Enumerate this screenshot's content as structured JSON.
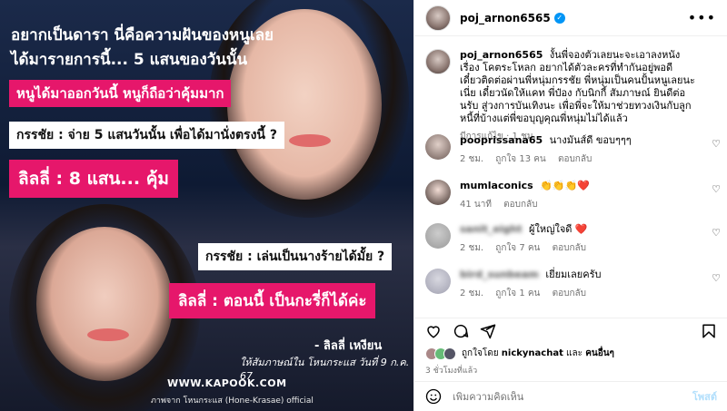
{
  "image": {
    "headline_line1": "อยากเป็นดารา นี่คือความฝันของหนูเลย",
    "headline_line2": "ได้มารายการนี้... 5 แสนของวันนั้น",
    "pink1": "หนูได้มาออกวันนี้ หนูก็ถือว่าคุ้มมาก",
    "white1": "กรรชัย : จ่าย 5 แสนวันนั้น เพื่อได้มานั่งตรงนี้ ?",
    "pink2": "ลิลลี่ : 8 แสน... คุ้ม",
    "white2": "กรรชัย : เล่นเป็นนางร้ายได้มั้ย ?",
    "pink3": "ลิลลี่ : ตอนนี้ เป็นกะรี่ก็ได้ค่ะ",
    "signer": "- ลิลลี่ เหงียน",
    "interview": "ให้สัมภาษณ์ใน โหนกระแส วันที่ 9 ก.ค. 67",
    "site": "WWW.KAPOOK.COM",
    "credit": "ภาพจาก โหนกระแส (Hone-Krasae) official",
    "colors": {
      "pink": "#e6176b",
      "bg": "#1b2a4a"
    }
  },
  "header": {
    "username": "poj_arnon6565",
    "verified_icon": "verified-badge-icon",
    "more_icon": "more-options-icon"
  },
  "caption": {
    "username": "poj_arnon6565",
    "text": "งั้นพี่จองตัวเลยนะจะเอาลงหนังเรื่อง โคตระโหลก อยากได้ตัวละครที่ทำกันอยู่พอดี เดี๋ยวติดต่อผ่านพี่หนุ่มกรรชัย พี่หนุ่มเป็นคนปั้นหนูเลยนะเนี่ย เดี๋ยวนัดให้แคท พี่ป๋อง กับนิกกี้ สัมภาษณ์ ยินดีต่อนรับ สู่วงการบันเทิงนะ เพื่อพี่จะให้มาช่วยทวงเงินกับลูกหนี้ที่บ้างแต่พี่ขอบุญคุณพี่หนุ่มไม่ได้แล้ว",
    "meta": "มีการแก้ไข · 1 ชม."
  },
  "comments": [
    {
      "user": "pooprissana65",
      "text": "นางมันส์ดี ขอบๆๆๆ",
      "time": "2 ชม.",
      "likes": "ถูกใจ 13 คน",
      "reply": "ตอบกลับ"
    },
    {
      "user": "mumlaconics",
      "text": "👏👏👏❤️",
      "time": "41 นาที",
      "likes": "",
      "reply": "ตอบกลับ"
    },
    {
      "user": "sanit_eight",
      "text": "ผู้ใหญ่ใจดี ❤️",
      "time": "2 ชม.",
      "likes": "ถูกใจ 7 คน",
      "reply": "ตอบกลับ"
    },
    {
      "user": "bird_sunbeam",
      "text": "เยี่ยมเลยครับ",
      "time": "2 ชม.",
      "likes": "ถูกใจ 1 คน",
      "reply": "ตอบกลับ"
    }
  ],
  "actions": {
    "like_icon": "heart-icon",
    "comment_icon": "comment-icon",
    "share_icon": "share-icon",
    "save_icon": "bookmark-icon"
  },
  "likes": {
    "prefix": "ถูกใจโดย",
    "user": "nickynachat",
    "mid": "และ",
    "others": "คนอื่นๆ",
    "time_ago": "3 ชั่วโมงที่แล้ว"
  },
  "composer": {
    "placeholder": "เพิ่มความคิดเห็น",
    "post_label": "โพสต์"
  }
}
